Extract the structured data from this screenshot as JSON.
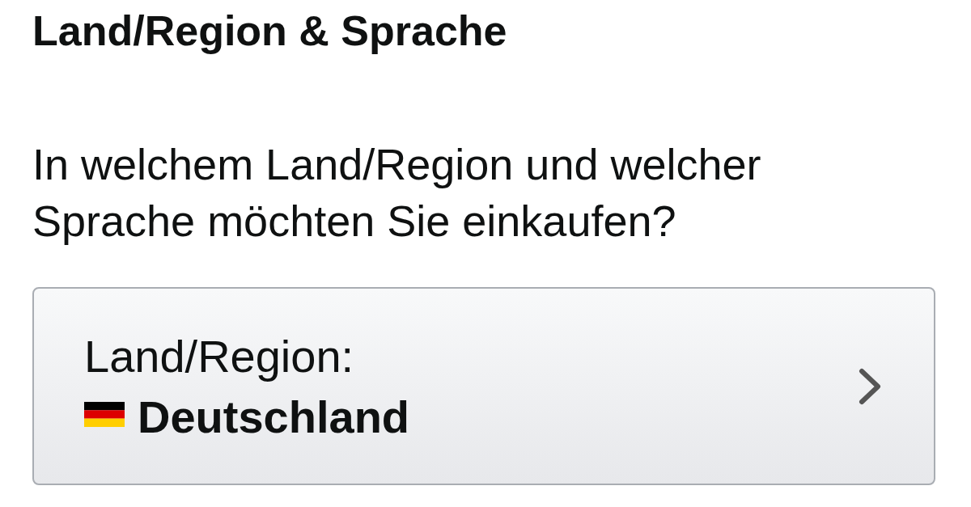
{
  "heading": "Land/Region & Sprache",
  "question": "In welchem Land/Region und welcher Sprache möchten Sie einkaufen?",
  "country_selector": {
    "label": "Land/Region:",
    "value": "Deutschland"
  }
}
